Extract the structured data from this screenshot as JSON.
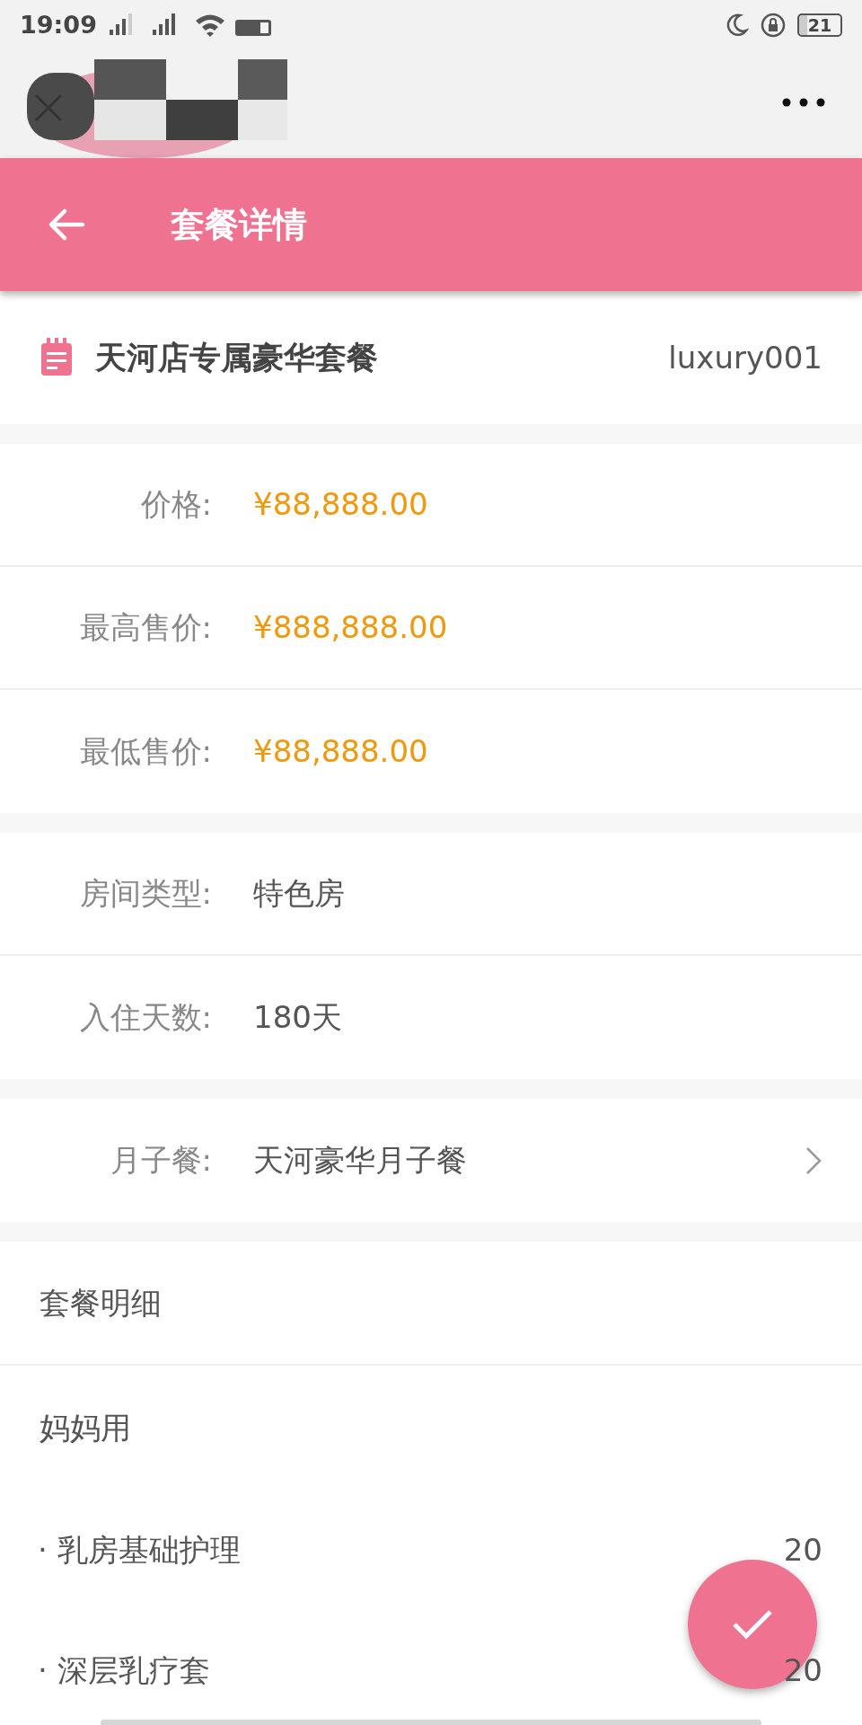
{
  "status_bar": {
    "time": "19:09",
    "battery": "21"
  },
  "browser_bar": {
    "kind": "picture"
  },
  "app_bar": {
    "title": "套餐详情"
  },
  "package": {
    "name": "天河店专属豪华套餐",
    "code": "luxury001"
  },
  "groups": [
    [
      {
        "label": "价格:",
        "value": "¥88,888.00",
        "kind": "price"
      },
      {
        "label": "最高售价:",
        "value": "¥888,888.00",
        "kind": "price"
      },
      {
        "label": "最低售价:",
        "value": "¥88,888.00",
        "kind": "price"
      }
    ],
    [
      {
        "label": "房间类型:",
        "value": "特色房",
        "kind": "plain"
      },
      {
        "label": "入住天数:",
        "value": "180天",
        "kind": "plain"
      }
    ],
    [
      {
        "label": "月子餐:",
        "value": "天河豪华月子餐",
        "kind": "link"
      }
    ]
  ],
  "details": {
    "title": "套餐明细",
    "section": "妈妈用",
    "items": [
      {
        "name": "· 乳房基础护理",
        "qty": "20"
      },
      {
        "name": "· 深层乳疗套",
        "qty": "20"
      }
    ]
  }
}
